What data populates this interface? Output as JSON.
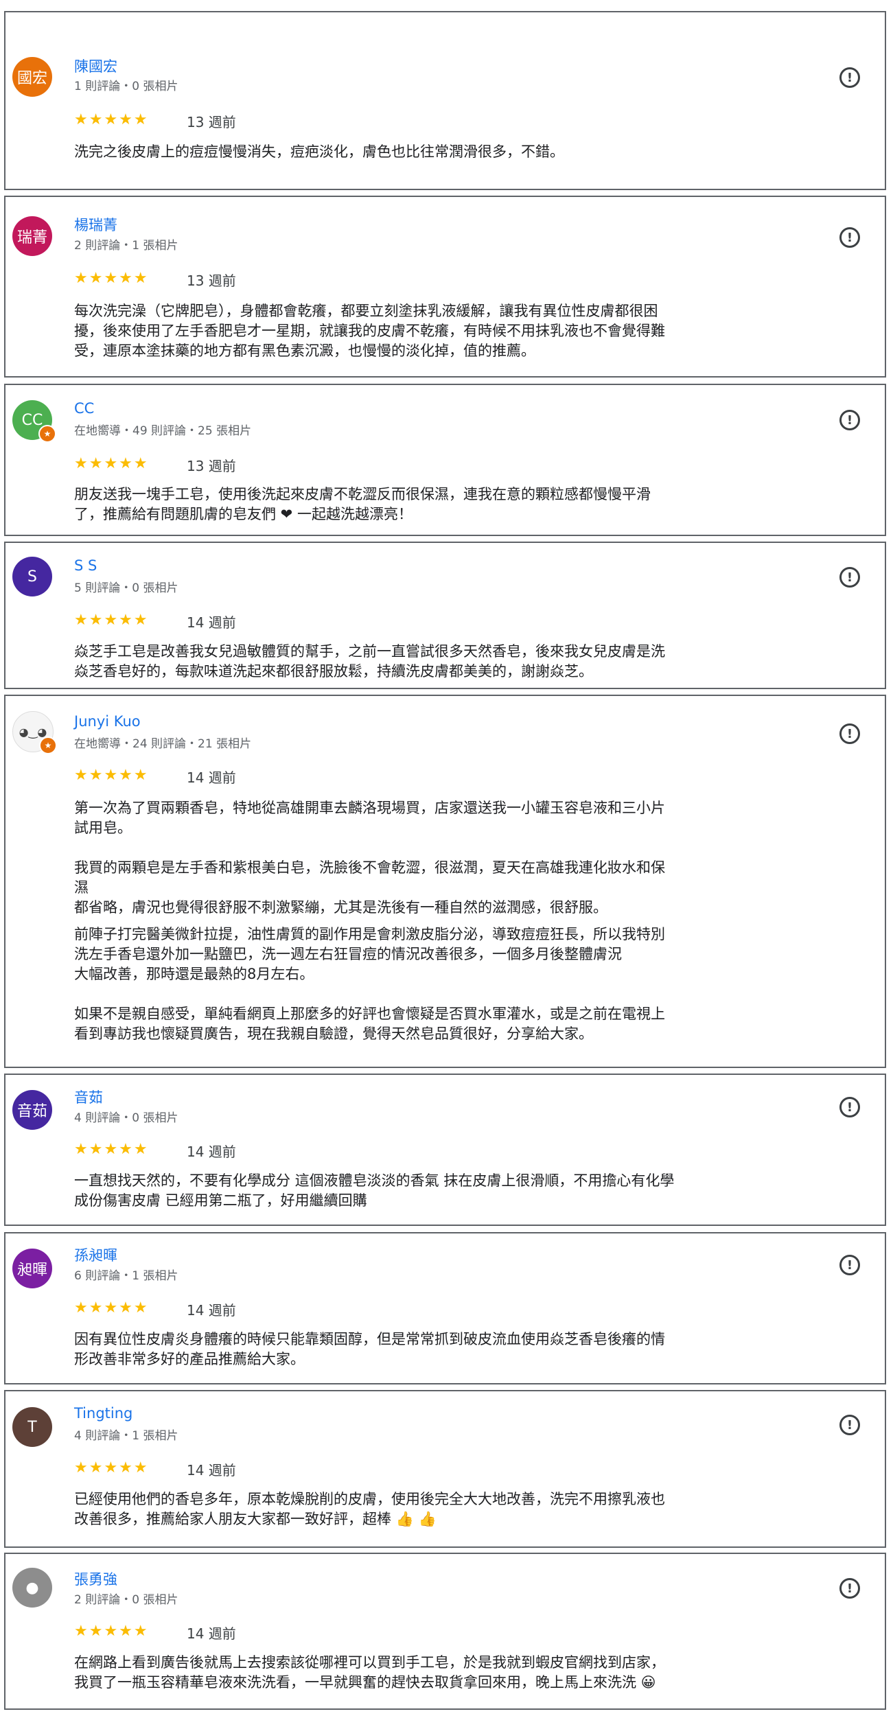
{
  "reviews": [
    {
      "name": "陳國宏",
      "avatar_text": "國宏",
      "avatar_color": "#e8710a",
      "meta": "1 則評論・0 張相片",
      "stars": "★★★★★",
      "date": "13 週前",
      "text": [
        "洗完之後皮膚上的痘痘慢慢消失，痘疤淡化，膚色也比往常潤滑很多，不錯。"
      ]
    },
    {
      "name": "楊瑞菁",
      "avatar_text": "瑞菁",
      "avatar_color": "#c2185b",
      "meta": "2 則評論・1 張相片",
      "stars": "★★★★★",
      "date": "13 週前",
      "text": [
        "每次洗完澡（它牌肥皂），身體都會乾癢，都要立刻塗抹乳液緩解，讓我有異位性皮膚都很困",
        "擾，後來使用了左手香肥皂才一星期，就讓我的皮膚不乾癢，有時候不用抹乳液也不會覺得難",
        "受，連原本塗抹藥的地方都有黑色素沉澱，也慢慢的淡化掉，值的推薦。"
      ]
    },
    {
      "name": "CC",
      "avatar_text": "CC",
      "avatar_color": "#4caf50",
      "meta": "在地嚮導・49 則評論・25 張相片",
      "stars": "★★★★★",
      "date": "13 週前",
      "local_guide": true,
      "text": [
        "朋友送我一塊手工皂，使用後洗起來皮膚不乾澀反而很保濕，連我在意的顆粒感都慢慢平滑",
        "了，推薦給有問題肌膚的皂友們 ❤ 一起越洗越漂亮！"
      ]
    },
    {
      "name": "S S",
      "avatar_text": "S",
      "avatar_color": "#4527a0",
      "meta": "5 則評論・0 張相片",
      "stars": "★★★★★",
      "date": "14 週前",
      "text": [
        "焱芝手工皂是改善我女兒過敏體質的幫手，之前一直嘗試很多天然香皂，後來我女兒皮膚是洗",
        "焱芝香皂好的，每款味道洗起來都很舒服放鬆，持續洗皮膚都美美的，謝謝焱芝。"
      ]
    },
    {
      "name": "Junyi Kuo",
      "avatar_text": "◕‿◕",
      "avatar_color": "#f5f5f5",
      "meta": "在地嚮導・24 則評論・21 張相片",
      "stars": "★★★★★",
      "date": "14 週前",
      "local_guide": true,
      "text": [
        "第一次為了買兩顆香皂，特地從高雄開車去麟洛現場買，店家還送我一小罐玉容皂液和三小片",
        "試用皂。",
        "",
        "我買的兩顆皂是左手香和紫根美白皂，洗臉後不會乾澀，很滋潤，夏天在高雄我連化妝水和保",
        "濕",
        "都省略，膚況也覺得很舒服不刺激緊繃，尤其是洗後有一種自然的滋潤感，很舒服。",
        "前陣子打完醫美微針拉提，油性膚質的副作用是會刺激皮脂分泌，導致痘痘狂長，所以我特別",
        "洗左手香皂還外加一點鹽巴，洗一週左右狂冒痘的情況改善很多，一個多月後整體膚況",
        "大幅改善，那時還是最熱的8月左右。",
        "",
        "如果不是親自感受，單純看網頁上那麼多的好評也會懷疑是否買水軍灌水，或是之前在電視上",
        "看到專訪我也懷疑買廣告，現在我親自驗證，覺得天然皂品質很好，分享給大家。"
      ]
    },
    {
      "name": "音茹",
      "avatar_text": "音茹",
      "avatar_color": "#4527a0",
      "meta": "4 則評論・0 張相片",
      "stars": "★★★★★",
      "date": "14 週前",
      "text": [
        "一直想找天然的，不要有化學成分 這個液體皂淡淡的香氣 抹在皮膚上很滑順，不用擔心有化學",
        "成份傷害皮膚 已經用第二瓶了，好用繼續回購"
      ]
    },
    {
      "name": "孫昶暉",
      "avatar_text": "昶暉",
      "avatar_color": "#7b1fa2",
      "meta": "6 則評論・1 張相片",
      "stars": "★★★★★",
      "date": "14 週前",
      "text": [
        "因有異位性皮膚炎身體癢的時候只能靠類固醇，但是常常抓到破皮流血使用焱芝香皂後癢的情",
        "形改善非常多好的產品推薦給大家。"
      ]
    },
    {
      "name": "Tingting",
      "avatar_text": "T",
      "avatar_color": "#5d4037",
      "meta": "4 則評論・1 張相片",
      "stars": "★★★★★",
      "date": "14 週前",
      "text": [
        "已經使用他們的香皂多年，原本乾燥脫削的皮膚，使用後完全大大地改善，洗完不用擦乳液也",
        "改善很多，推薦給家人朋友大家都一致好評，超棒 👍 👍"
      ]
    },
    {
      "name": "張勇強",
      "avatar_text": "●",
      "avatar_color": "#8d8d8d",
      "meta": "2 則評論・0 張相片",
      "stars": "★★★★★",
      "date": "14 週前",
      "text": [
        "在網路上看到廣告後就馬上去搜索該從哪裡可以買到手工皂，於是我就到蝦皮官網找到店家，",
        "我買了一瓶玉容精華皂液來洗洗看，一早就興奮的趕快去取貨拿回來用，晚上馬上來洗洗 😀"
      ]
    }
  ],
  "report_icon": "exclamation-circle-icon",
  "colors": {
    "name": "#1a73e8",
    "star": "#fbbc04",
    "border": "#5f6368"
  }
}
